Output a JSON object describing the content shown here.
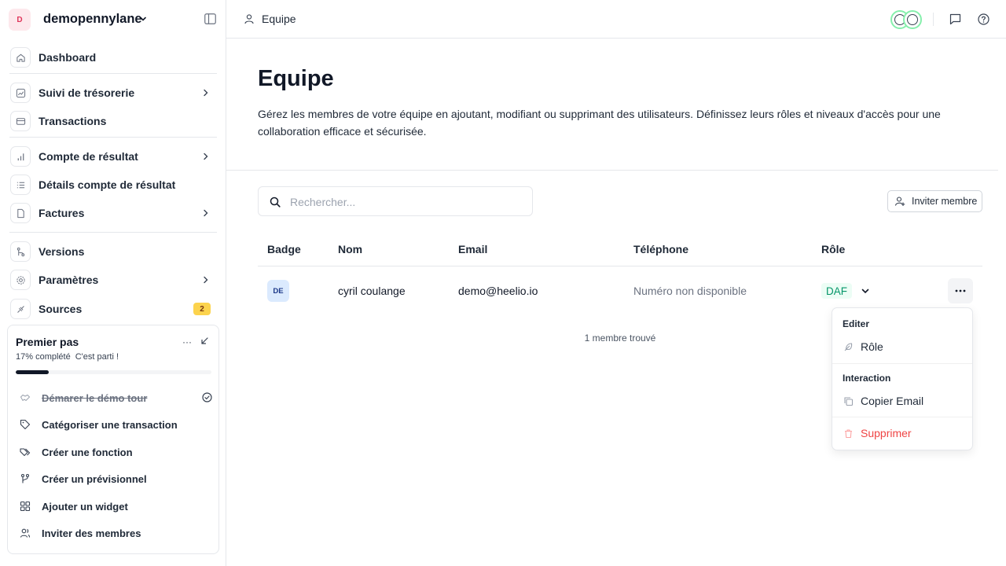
{
  "workspace": {
    "avatar_initial": "D",
    "name": "demopennylane"
  },
  "sidebar": {
    "items": [
      {
        "label": "Dashboard",
        "icon": "home-icon"
      },
      {
        "label": "Suivi de trésorerie",
        "icon": "chart-line-icon"
      },
      {
        "label": "Transactions",
        "icon": "credit-card-icon"
      },
      {
        "label": "Compte de résultat",
        "icon": "bar-chart-icon"
      },
      {
        "label": "Détails compte de résultat",
        "icon": "list-icon"
      },
      {
        "label": "Factures",
        "icon": "file-icon"
      },
      {
        "label": "Versions",
        "icon": "git-branch-icon"
      },
      {
        "label": "Paramètres",
        "icon": "gear-icon"
      },
      {
        "label": "Sources",
        "icon": "plug-icon",
        "badge": "2"
      }
    ]
  },
  "onboarding": {
    "title": "Premier pas",
    "progress_text": "17% complété",
    "cta_text": "C'est parti !",
    "progress": 0.17,
    "tasks": [
      {
        "label": "Démarer le démo tour",
        "done": true,
        "icon": "handshake-icon"
      },
      {
        "label": "Catégoriser une transaction",
        "done": false,
        "icon": "tag-icon"
      },
      {
        "label": "Créer une fonction",
        "done": false,
        "icon": "tags-icon"
      },
      {
        "label": "Créer un prévisionnel",
        "done": false,
        "icon": "git-branch-icon"
      },
      {
        "label": "Ajouter un widget",
        "done": false,
        "icon": "grid-icon"
      },
      {
        "label": "Inviter des membres",
        "done": false,
        "icon": "users-icon"
      }
    ]
  },
  "topbar": {
    "breadcrumb": "Equipe"
  },
  "page": {
    "title": "Equipe",
    "description": "Gérez les membres de votre équipe en ajoutant, modifiant ou supprimant des utilisateurs. Définissez leurs rôles et niveaux d'accès pour une collaboration efficace et sécurisée."
  },
  "search": {
    "placeholder": "Rechercher..."
  },
  "invite_button": "Inviter membre",
  "table": {
    "headers": [
      "Badge",
      "Nom",
      "Email",
      "Téléphone",
      "Rôle"
    ],
    "rows": [
      {
        "badge": "DE",
        "name": "cyril coulange",
        "email": "demo@heelio.io",
        "phone": "Numéro non disponible",
        "role": "DAF"
      }
    ],
    "count_text": "1 membre trouvé"
  },
  "menu": {
    "section_edit": "Editer",
    "role": "Rôle",
    "section_interaction": "Interaction",
    "copy_email": "Copier Email",
    "delete": "Supprimer"
  },
  "colors": {
    "accent_green": "#059669",
    "danger": "#ef4444",
    "badge_yellow": "#fcd34d"
  }
}
